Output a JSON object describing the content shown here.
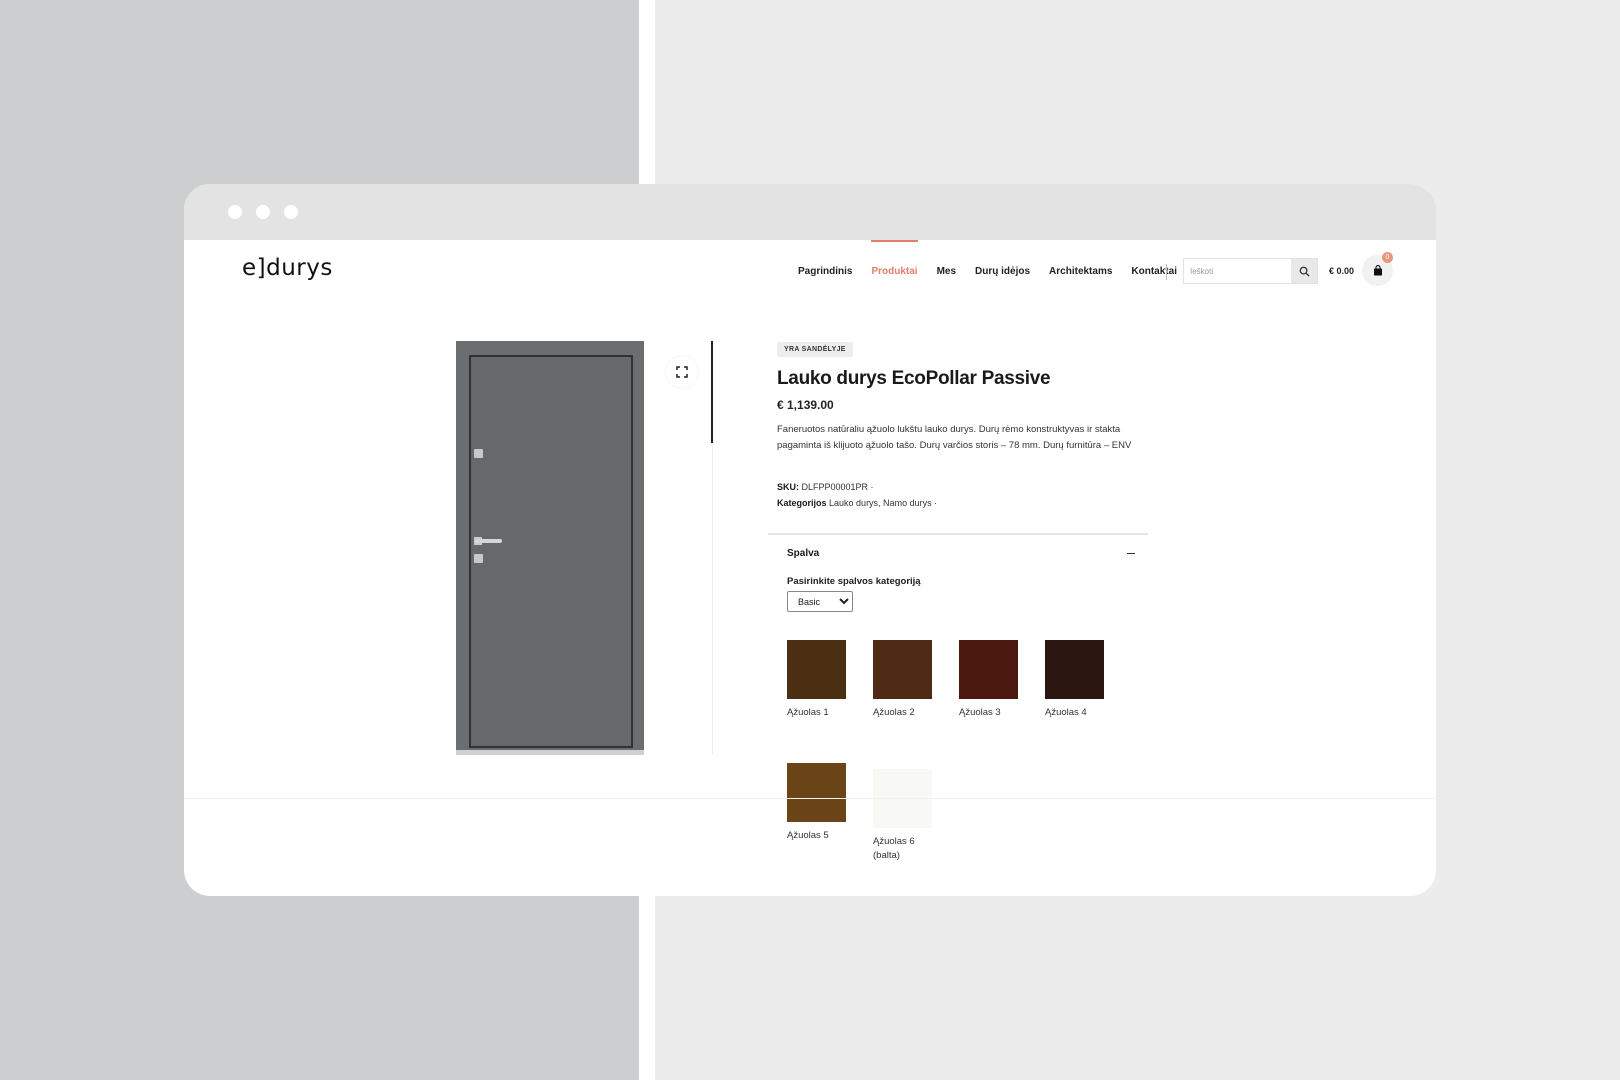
{
  "header": {
    "logo": "e]durys",
    "nav": [
      "Pagrindinis",
      "Produktai",
      "Mes",
      "Durų idėjos",
      "Architektams",
      "Kontaktai"
    ],
    "active_nav": "Produktai",
    "search_placeholder": "Ieškoti",
    "cart_total": "€ 0.00",
    "cart_count": "0"
  },
  "product": {
    "stock_badge": "YRA SANDĖLYJE",
    "title": "Lauko durys EcoPollar Passive",
    "price": "€ 1,139.00",
    "description": "Faneruotos natūraliu ąžuolo lukštu lauko durys. Durų rėmo konstruktyvas ir stakta pagaminta iš klijuoto ąžuolo tašo. Durų varčios storis – 78 mm. Durų furnitūra – ENV",
    "sku_label": "SKU:",
    "sku_value": "DLFPP00001PR ·",
    "categories_label": "Kategorijos",
    "categories_value": "Lauko durys, Namo durys ·",
    "door_color": "#66696b"
  },
  "color_section": {
    "title": "Spalva",
    "select_label": "Pasirinkite spalvos kategoriją",
    "selected_category": "Basic",
    "swatches": [
      {
        "label": "Ąžuolas 1",
        "color": "#4a2f12"
      },
      {
        "label": "Ąžuolas 2",
        "color": "#4f2a14"
      },
      {
        "label": "Ąžuolas 3",
        "color": "#4b1810"
      },
      {
        "label": "Ąžuolas 4",
        "color": "#2c1612"
      },
      {
        "label": "Ąžuolas 5",
        "color": "#6b4517"
      },
      {
        "label": "Ąžuolas 6 (balta)",
        "color": "#f8f8f5"
      }
    ]
  }
}
